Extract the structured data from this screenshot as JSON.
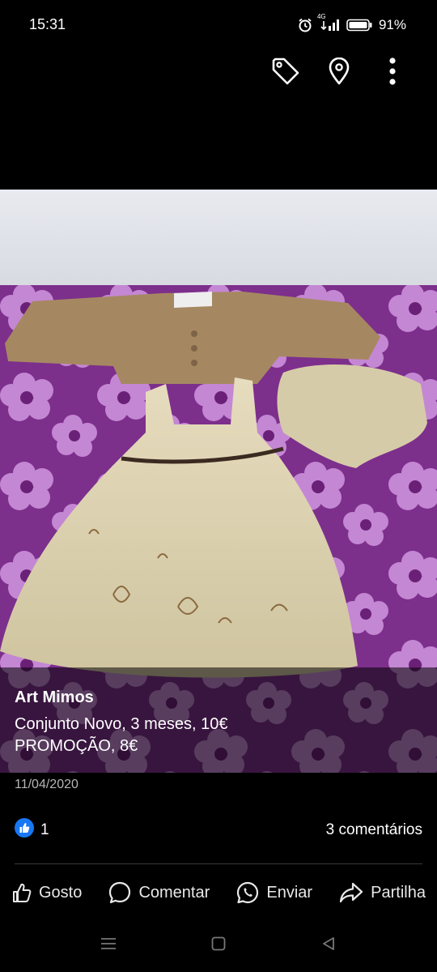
{
  "status_bar": {
    "time": "15:31",
    "network": "4G",
    "battery": "91%"
  },
  "top_actions": {
    "icons": [
      "tag-icon",
      "location-pin-icon",
      "more-vertical-icon"
    ]
  },
  "photo": {
    "description_icon": "photo"
  },
  "post": {
    "author": "Art Mimos",
    "text_lines": [
      "Conjunto Novo, 3 meses, 10€",
      "PROMOÇÃO, 8€"
    ],
    "date": "11/04/2020"
  },
  "reactions": {
    "like_count": "1",
    "comments": "3 comentários"
  },
  "actions": {
    "like": "Gosto",
    "comment": "Comentar",
    "send": "Enviar",
    "share": "Partilha"
  },
  "colors": {
    "like_blue": "#1877F2",
    "background": "#000000",
    "date_grey": "#b6b6b6"
  }
}
